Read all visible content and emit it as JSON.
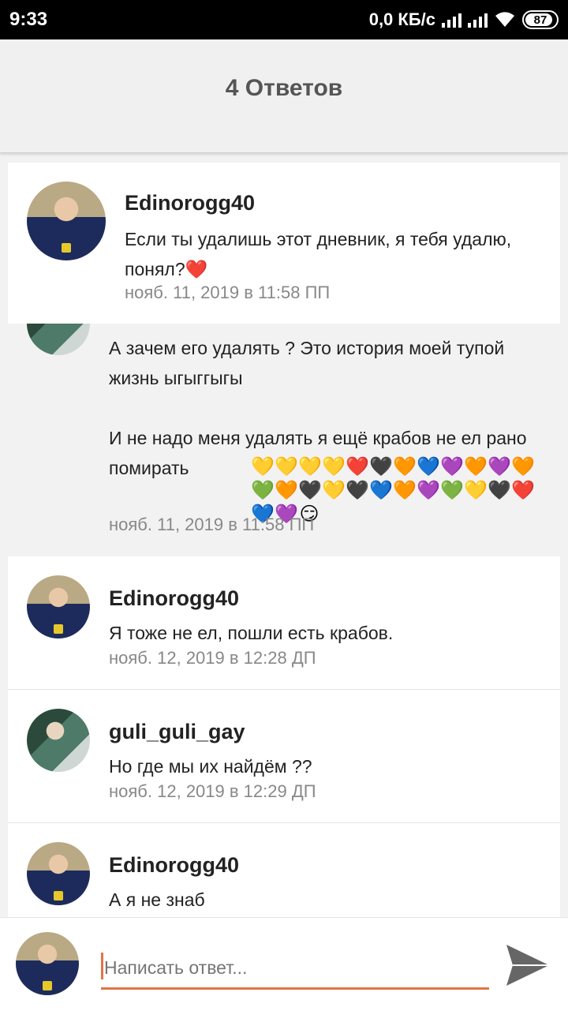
{
  "status_bar": {
    "time": "9:33",
    "net_speed": "0,0 КБ/с",
    "battery": "87"
  },
  "header": {
    "title": "4 Ответов"
  },
  "comments": [
    {
      "username": "Edinorogg40",
      "text": "Если ты удалишь этот дневник, я тебя удалю, понял?❤️",
      "time": "нояб. 11, 2019 в 11:58 ПП"
    },
    {
      "username": "",
      "text": "А зачем его удалять ? Это история моей тупой жизнь ыгыггыгы\n\nИ не надо меня удалять я ещё крабов не ел рано помирать",
      "emojis": [
        "💛",
        "💛",
        "💛",
        "💛",
        "❤️",
        "🖤",
        "🧡",
        "💙",
        "💜",
        "🧡",
        "💜",
        "🧡",
        "💚",
        "🧡",
        "🖤",
        "💛",
        "🖤",
        "💙",
        "🧡",
        "💜",
        "💚",
        "💛",
        "🖤",
        "❤️",
        "💙",
        "💜",
        "😏"
      ],
      "time": "нояб. 11, 2019 в 11:58 ПП"
    },
    {
      "username": "Edinorogg40",
      "text": "Я тоже не ел, пошли есть крабов.",
      "time": "нояб. 12, 2019 в 12:28 ДП"
    },
    {
      "username": "guli_guli_gay",
      "text": "Но где мы их найдём ??",
      "time": "нояб. 12, 2019 в 12:29 ДП"
    },
    {
      "username": "Edinorogg40",
      "text": "А я не знаб",
      "time": ""
    }
  ],
  "reply": {
    "placeholder": "Написать ответ..."
  },
  "colors": {
    "accent": "#e2744a"
  }
}
